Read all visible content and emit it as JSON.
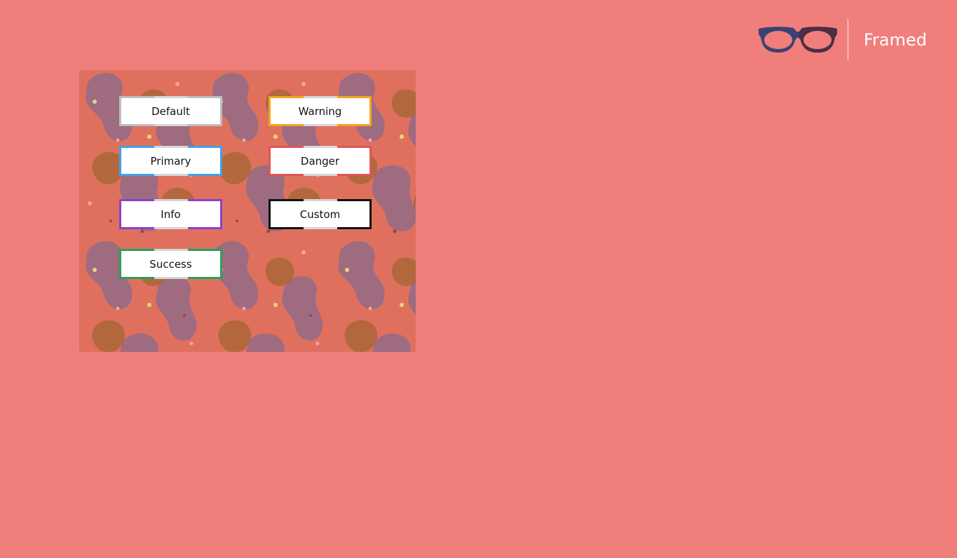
{
  "brand": {
    "name": "Framed",
    "logo_icon": "glasses-icon",
    "colors": {
      "left_lens": "#3b4174",
      "right_lens": "#4a2f45"
    }
  },
  "panel": {
    "background_color": "#e0705e",
    "blob_colors": [
      "#8a6a8c",
      "#a0642f",
      "#c85a4e"
    ],
    "buttons": [
      {
        "label": "Default",
        "border_color": "#bdbdbd"
      },
      {
        "label": "Warning",
        "border_color": "#f2a51f"
      },
      {
        "label": "Primary",
        "border_color": "#3fa1ea"
      },
      {
        "label": "Danger",
        "border_color": "#e05555"
      },
      {
        "label": "Info",
        "border_color": "#8b3fd1"
      },
      {
        "label": "Custom",
        "border_color": "#111111"
      },
      {
        "label": "Success",
        "border_color": "#27a25a"
      }
    ]
  },
  "page": {
    "background_color": "#f07f7c"
  }
}
